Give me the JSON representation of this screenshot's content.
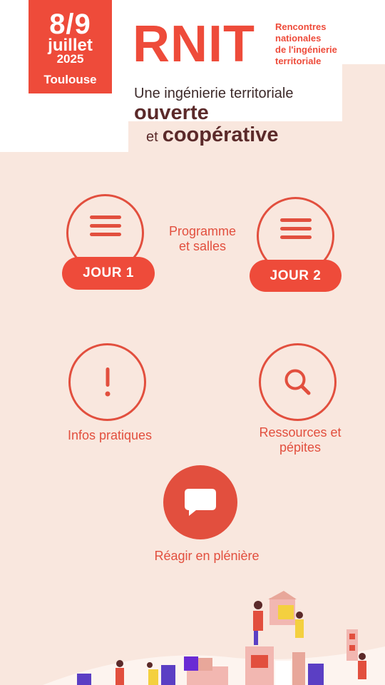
{
  "header": {
    "date_days": "8/9",
    "date_month": "juillet",
    "date_year": "2025",
    "date_city": "Toulouse",
    "logo": "RNIT",
    "logo_subtitle_1": "Rencontres",
    "logo_subtitle_2": "nationales",
    "logo_subtitle_3": "de l'ingénierie",
    "logo_subtitle_4": "territoriale",
    "tagline_1": "Une ingénierie territoriale",
    "tagline_2": "ouverte",
    "tagline_3_prefix": "et",
    "tagline_3_main": "coopérative"
  },
  "menu": {
    "programme_label_1": "Programme",
    "programme_label_2": "et salles",
    "day1_label": "JOUR 1",
    "day2_label": "JOUR 2",
    "infos_label": "Infos pratiques",
    "ressources_label_1": "Ressources et",
    "ressources_label_2": "pépites",
    "react_label": "Réagir en plénière"
  },
  "colors": {
    "accent": "#ee4b3a",
    "background": "#f9e7de",
    "text_dark": "#5b2a2a"
  },
  "icons": [
    "menu-icon",
    "exclamation-icon",
    "search-icon",
    "chat-icon"
  ]
}
